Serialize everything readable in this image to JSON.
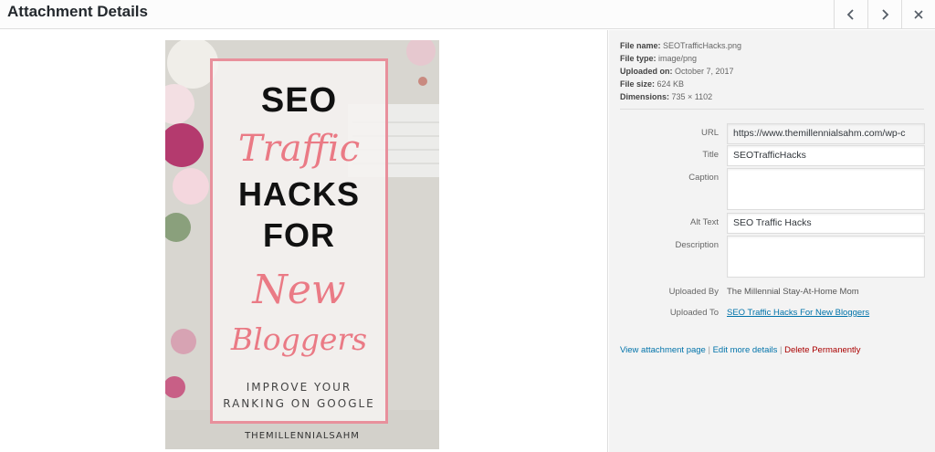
{
  "header": {
    "title": "Attachment Details",
    "prev_icon": "chevron-left-icon",
    "next_icon": "chevron-right-icon",
    "close_icon": "close-icon"
  },
  "poster": {
    "line1": "SEO",
    "line2": "Traffic",
    "line3": "HACKS",
    "line4": "FOR",
    "line5": "New",
    "line6": "Bloggers",
    "line7a": "IMPROVE YOUR",
    "line7b": "RANKING ON GOOGLE",
    "brand": "THEMILLENNIALSAHM",
    "frame_color": "#e8909c",
    "script_color": "#ea7a85"
  },
  "meta": {
    "file_name_label": "File name:",
    "file_name": "SEOTrafficHacks.png",
    "file_type_label": "File type:",
    "file_type": "image/png",
    "uploaded_on_label": "Uploaded on:",
    "uploaded_on": "October 7, 2017",
    "file_size_label": "File size:",
    "file_size": "624 KB",
    "dimensions_label": "Dimensions:",
    "dimensions": "735 × 1102"
  },
  "fields": {
    "url_label": "URL",
    "url_value": "https://www.themillennialsahm.com/wp-c",
    "title_label": "Title",
    "title_value": "SEOTrafficHacks",
    "caption_label": "Caption",
    "caption_value": "",
    "alt_label": "Alt Text",
    "alt_value": "SEO Traffic Hacks",
    "description_label": "Description",
    "description_value": "",
    "uploaded_by_label": "Uploaded By",
    "uploaded_by_value": "The Millennial Stay-At-Home Mom",
    "uploaded_to_label": "Uploaded To",
    "uploaded_to_value": "SEO Traffic Hacks For New Bloggers"
  },
  "links": {
    "view": "View attachment page",
    "sep1": " | ",
    "edit": "Edit more details",
    "sep2": " | ",
    "delete": "Delete Permanently",
    "link_color": "#0073aa",
    "delete_color": "#aa0000"
  }
}
